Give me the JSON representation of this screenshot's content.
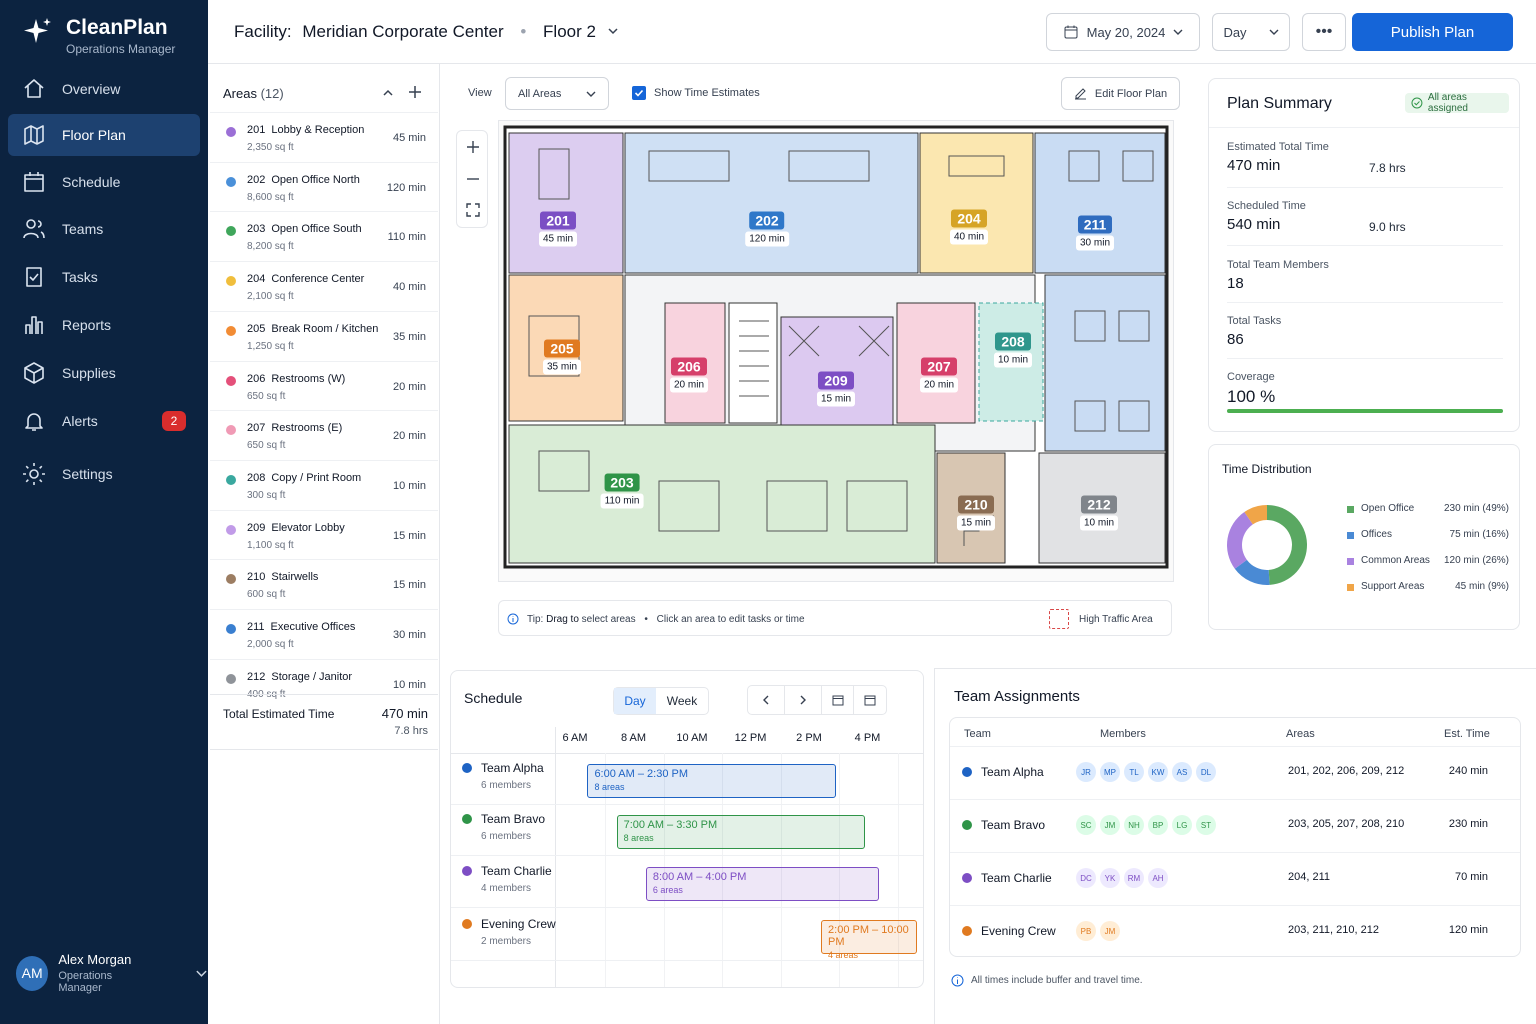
{
  "app": {
    "name": "CleanPlan",
    "subtitle": "Operations Manager"
  },
  "nav": [
    {
      "label": "Overview",
      "icon": "home-icon"
    },
    {
      "label": "Floor Plan",
      "icon": "map-icon",
      "active": true
    },
    {
      "label": "Schedule",
      "icon": "calendar-icon"
    },
    {
      "label": "Teams",
      "icon": "users-icon"
    },
    {
      "label": "Tasks",
      "icon": "checklist-icon"
    },
    {
      "label": "Reports",
      "icon": "bar-chart-icon"
    },
    {
      "label": "Supplies",
      "icon": "box-icon"
    },
    {
      "label": "Alerts",
      "icon": "bell-icon",
      "badge": "2"
    },
    {
      "label": "Settings",
      "icon": "gear-icon"
    }
  ],
  "user": {
    "initials": "AM",
    "name": "Alex Morgan",
    "role": "Operations Manager"
  },
  "header": {
    "facility_label": "Facility:",
    "facility": "Meridian Corporate Center",
    "floor": "Floor 2",
    "date": "May 20, 2024",
    "view": "Day",
    "publish": "Publish Plan"
  },
  "areas": {
    "title": "Areas",
    "count": "(12)",
    "items": [
      {
        "num": "201",
        "name": "Lobby & Reception",
        "sqft": "2,350 sq ft",
        "min": "45 min",
        "color": "#9b6fd6"
      },
      {
        "num": "202",
        "name": "Open Office North",
        "sqft": "8,600 sq ft",
        "min": "120 min",
        "color": "#4a90d9"
      },
      {
        "num": "203",
        "name": "Open Office South",
        "sqft": "8,200 sq ft",
        "min": "110 min",
        "color": "#3fa65b"
      },
      {
        "num": "204",
        "name": "Conference Center",
        "sqft": "2,100 sq ft",
        "min": "40 min",
        "color": "#f0be3c"
      },
      {
        "num": "205",
        "name": "Break Room / Kitchen",
        "sqft": "1,250 sq ft",
        "min": "35 min",
        "color": "#f28c34"
      },
      {
        "num": "206",
        "name": "Restrooms (W)",
        "sqft": "650 sq ft",
        "min": "20 min",
        "color": "#e4507a"
      },
      {
        "num": "207",
        "name": "Restrooms (E)",
        "sqft": "650 sq ft",
        "min": "20 min",
        "color": "#f09ab5"
      },
      {
        "num": "208",
        "name": "Copy / Print Room",
        "sqft": "300 sq ft",
        "min": "10 min",
        "color": "#3aa89f"
      },
      {
        "num": "209",
        "name": "Elevator Lobby",
        "sqft": "1,100 sq ft",
        "min": "15 min",
        "color": "#c19be8"
      },
      {
        "num": "210",
        "name": "Stairwells",
        "sqft": "600 sq ft",
        "min": "15 min",
        "color": "#9c7d62"
      },
      {
        "num": "211",
        "name": "Executive Offices",
        "sqft": "2,000 sq ft",
        "min": "30 min",
        "color": "#3a7fd0"
      },
      {
        "num": "212",
        "name": "Storage / Janitor",
        "sqft": "400 sq ft",
        "min": "10 min",
        "color": "#8f9399"
      }
    ],
    "total_label": "Total Estimated Time",
    "total_min": "470 min",
    "total_hrs": "7.8 hrs"
  },
  "floorplan": {
    "view_label": "View",
    "view_value": "All Areas",
    "show_time": "Show Time Estimates",
    "edit": "Edit Floor Plan",
    "rooms": [
      {
        "num": "201",
        "min": "45 min",
        "color": "#7b4fc4"
      },
      {
        "num": "202",
        "min": "120 min",
        "color": "#2f78c9"
      },
      {
        "num": "204",
        "min": "40 min",
        "color": "#d6a426"
      },
      {
        "num": "211",
        "min": "30 min",
        "color": "#2f6cbf"
      },
      {
        "num": "205",
        "min": "35 min",
        "color": "#e07a20"
      },
      {
        "num": "206",
        "min": "20 min",
        "color": "#d63f6a"
      },
      {
        "num": "209",
        "min": "15 min",
        "color": "#7d4ec4"
      },
      {
        "num": "207",
        "min": "20 min",
        "color": "#d63f6a"
      },
      {
        "num": "208",
        "min": "10 min",
        "color": "#2f968c"
      },
      {
        "num": "203",
        "min": "110 min",
        "color": "#2f9448"
      },
      {
        "num": "210",
        "min": "15 min",
        "color": "#8a6c52"
      },
      {
        "num": "212",
        "min": "10 min",
        "color": "#80858b"
      }
    ],
    "tip_prefix": "Tip:",
    "tip_bold": "Drag to",
    "tip_rest": "select areas",
    "tip2": "Click an area to edit tasks or time",
    "legend": "High Traffic Area"
  },
  "summary": {
    "title": "Plan Summary",
    "status": "All areas assigned",
    "est_label": "Estimated Total Time",
    "est_min": "470 min",
    "est_hrs": "7.8 hrs",
    "sched_label": "Scheduled Time",
    "sched_min": "540 min",
    "sched_hrs": "9.0 hrs",
    "members_label": "Total Team Members",
    "members": "18",
    "tasks_label": "Total Tasks",
    "tasks": "86",
    "coverage_label": "Coverage",
    "coverage": "100 %",
    "coverage_pct": 100
  },
  "chart_data": {
    "type": "pie",
    "title": "Time Distribution",
    "categories": [
      "Open Office",
      "Offices",
      "Common Areas",
      "Support Areas"
    ],
    "values": [
      230,
      75,
      120,
      45
    ],
    "labels": [
      "230 min (49%)",
      "75 min (16%)",
      "120 min (26%)",
      "45 min (9%)"
    ],
    "colors": [
      "#5aa862",
      "#4a8ad4",
      "#a982e0",
      "#f0a548"
    ]
  },
  "schedule": {
    "title": "Schedule",
    "tab_day": "Day",
    "tab_week": "Week",
    "times": [
      "6 AM",
      "8 AM",
      "10 AM",
      "12 PM",
      "2 PM",
      "4 PM"
    ],
    "rows": [
      {
        "name": "Team Alpha",
        "members": "6 members",
        "range": "6:00 AM – 2:30 PM",
        "areas": "8 areas",
        "color": "#1e63c4",
        "start": 6,
        "end": 14.5
      },
      {
        "name": "Team Bravo",
        "members": "6 members",
        "range": "7:00 AM – 3:30 PM",
        "areas": "8 areas",
        "color": "#2f9448",
        "start": 7,
        "end": 15.5
      },
      {
        "name": "Team Charlie",
        "members": "4 members",
        "range": "8:00 AM – 4:00 PM",
        "areas": "6 areas",
        "color": "#7d4ec4",
        "start": 8,
        "end": 16
      },
      {
        "name": "Evening Crew",
        "members": "2 members",
        "range": "2:00 PM – 10:00 PM",
        "areas": "4 areas",
        "color": "#e07a20",
        "start": 14,
        "end": 22
      }
    ]
  },
  "assignments": {
    "title": "Team Assignments",
    "headers": [
      "Team",
      "Members",
      "Areas",
      "Est. Time"
    ],
    "rows": [
      {
        "team": "Team Alpha",
        "color": "#1e63c4",
        "members": [
          "JR",
          "MP",
          "TL",
          "KW",
          "AS",
          "DL"
        ],
        "areas": "201, 202, 206, 209, 212",
        "time": "240 min"
      },
      {
        "team": "Team Bravo",
        "color": "#2f9448",
        "members": [
          "SC",
          "JM",
          "NH",
          "BP",
          "LG",
          "ST"
        ],
        "areas": "203, 205, 207, 208, 210",
        "time": "230 min"
      },
      {
        "team": "Team Charlie",
        "color": "#7d4ec4",
        "members": [
          "DC",
          "YK",
          "RM",
          "AH"
        ],
        "areas": "204, 211",
        "time": "70 min"
      },
      {
        "team": "Evening Crew",
        "color": "#e07a20",
        "members": [
          "PB",
          "JM"
        ],
        "areas": "203, 211, 210, 212",
        "time": "120 min"
      }
    ],
    "note": "All times include buffer and travel time."
  }
}
